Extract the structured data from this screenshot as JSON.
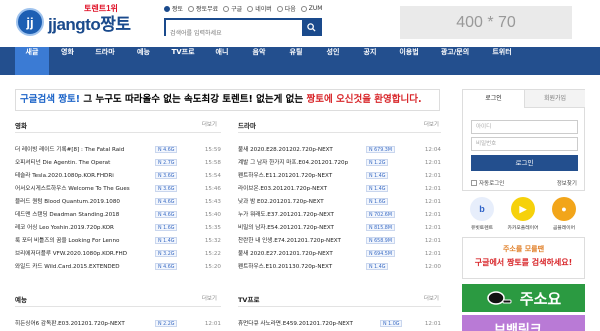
{
  "header": {
    "logo_mark": "jj",
    "logo_text": "jjangto",
    "logo_text_kr": "짱토",
    "rank_badge": "토렌트1위",
    "search_options": [
      "짱토",
      "짱토무료",
      "구글",
      "네이버",
      "다음",
      "ZUM"
    ],
    "search_placeholder": "검색어를 입력하세요",
    "ad_banner": "400 * 70"
  },
  "nav": {
    "items": [
      "새글",
      "영화",
      "드라마",
      "예능",
      "TV프로",
      "애니",
      "음악",
      "유틸",
      "성인",
      "공지",
      "이용법",
      "광고/문의",
      "트위터"
    ],
    "active": "새글"
  },
  "welcome": {
    "part1": "구글검색 짱토!",
    "part2": " 그 누구도 따라올수 없는 속도최강 토렌트! 없는게 없는 ",
    "part3": "짱토에 오신것을 환영합니다."
  },
  "sections": {
    "movie": {
      "title": "영화",
      "more": "더보기",
      "rows": [
        {
          "title": "더 레이빙 레이드 기록#[8] : The Fatal Raid",
          "badge": "N 4.6G",
          "time": "15:59"
        },
        {
          "title": "오피셔티넌 Die Agentin. The Operat",
          "badge": "N 2.7G",
          "time": "15:58"
        },
        {
          "title": "테슬라 Tesla.2020.1080p.KOR.FHDRi",
          "badge": "N 3.6G",
          "time": "15:54"
        },
        {
          "title": "어서오시게스트하우스 Welcome To The Gues",
          "badge": "N 3.6G",
          "time": "15:46"
        },
        {
          "title": "블러드 퀀텀 Blood Quantum.2019.1080",
          "badge": "N 4.6G",
          "time": "15:43"
        },
        {
          "title": "데드맨 스탠딩 Deadman Standing.2018",
          "badge": "N 4.6G",
          "time": "15:40"
        },
        {
          "title": "레코 어싱 Leo Yoshin.2019.720p.KOR",
          "badge": "N 1.6G",
          "time": "15:35"
        },
        {
          "title": "룩 포터 비틀즈의 꿈을 Looking For Lenno",
          "badge": "N 1.4G",
          "time": "15:32"
        },
        {
          "title": "브리에저더플루 VFW.2020.1080p.KOR.FHD",
          "badge": "N 3.2G",
          "time": "15:22"
        },
        {
          "title": "와일드 카드 Wild.Card.2015.EXTENDED",
          "badge": "N 4.6G",
          "time": "15:20"
        }
      ]
    },
    "drama": {
      "title": "드라마",
      "more": "더보기",
      "rows": [
        {
          "title": "불새 2020.E28.201202.720p-NEXT",
          "badge": "N 679.3M",
          "time": "12:04"
        },
        {
          "title": "계발 그 남자 한가지 마프.E04.201201.720p",
          "badge": "N 1.2G",
          "time": "12:01"
        },
        {
          "title": "펜트하우스.E11.201201.720p-NEXT",
          "badge": "N 1.4G",
          "time": "12:01"
        },
        {
          "title": "라이브온.E03.201201.720p-NEXT",
          "badge": "N 1.4G",
          "time": "12:01"
        },
        {
          "title": "낮과 밤 E02.201201.720p-NEXT",
          "badge": "N 1.6G",
          "time": "12:01"
        },
        {
          "title": "누가 뭐래도.E37.201201.720p-NEXT",
          "badge": "N 702.6M",
          "time": "12:01"
        },
        {
          "title": "비밀의 남자.E54.201201.720p-NEXT",
          "badge": "N 815.8M",
          "time": "12:01"
        },
        {
          "title": "찬란한 내 인생.E74.201201.720p-NEXT",
          "badge": "N 658.9M",
          "time": "12:01"
        },
        {
          "title": "불새 2020.E27.201201.720p-NEXT",
          "badge": "N 694.5M",
          "time": "12:01"
        },
        {
          "title": "펜트하우스.E10.201130.720p-NEXT",
          "badge": "N 1.4G",
          "time": "12:00"
        }
      ]
    },
    "variety": {
      "title": "예능",
      "more": "더보기",
      "rows": [
        {
          "title": "히든싱어6 감독판.E03.201201.720p-NEXT",
          "badge": "N 2.2G",
          "time": "12:01"
        }
      ]
    },
    "tv": {
      "title": "TV프로",
      "more": "더보기",
      "rows": [
        {
          "title": "휴먼다큐 사노라면.E459.201201.720p-NEXT",
          "badge": "N 1.0G",
          "time": "12:01"
        }
      ]
    }
  },
  "login": {
    "tab_login": "로그인",
    "tab_register": "회원가입",
    "id_placeholder": "아이디",
    "pw_placeholder": "비밀번호",
    "button": "로그인",
    "remember": "자동로그인",
    "find": "정보찾기"
  },
  "apps": [
    {
      "label": "유빗토렌트",
      "icon": "b",
      "color": "#2f63c7"
    },
    {
      "label": "카카오플레이어",
      "icon": "▶",
      "color": "#f6d10b"
    },
    {
      "label": "곰플레이어",
      "icon": "●",
      "color": "#f2a51a"
    }
  ],
  "promo": {
    "line1": "주소를 모를땐",
    "line2": "구글에서 짱토를 검색하세요!"
  },
  "banners": {
    "jusoyo": "주소요",
    "purple": "브밴링크"
  },
  "colors": {
    "nav_bg": "#234f8e",
    "nav_active": "#3b7bd4",
    "brand_blue": "#1c64c8",
    "brand_red": "#d8262a",
    "badge_text": "#3b6cc4"
  }
}
